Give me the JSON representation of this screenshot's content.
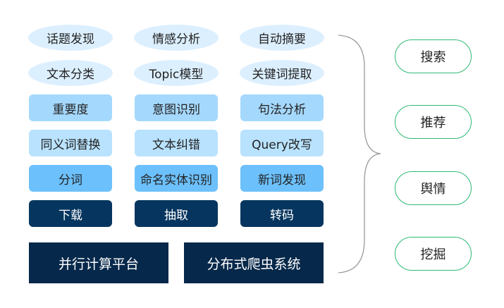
{
  "layers": {
    "row1": [
      "话题发现",
      "情感分析",
      "自动摘要"
    ],
    "row2": [
      "文本分类",
      "Topic模型",
      "关键词提取"
    ],
    "row3": [
      "重要度",
      "意图识别",
      "句法分析"
    ],
    "row4": [
      "同义词替换",
      "文本纠错",
      "Query改写"
    ],
    "row5": [
      "分词",
      "命名实体识别",
      "新词发现"
    ],
    "row6": [
      "下载",
      "抽取",
      "转码"
    ],
    "base": [
      "并行计算平台",
      "分布式爬虫系统"
    ]
  },
  "applications": [
    "搜索",
    "推荐",
    "舆情",
    "挖掘"
  ],
  "colors": {
    "ellipse": "#dcefff",
    "pale": "#a5d8fd",
    "light": "#b9e2fe",
    "mid": "#6cc0fb",
    "dark": "#06365f",
    "base": "#06284a",
    "app_border": "#2dba73",
    "brace": "#9a9a9a"
  }
}
